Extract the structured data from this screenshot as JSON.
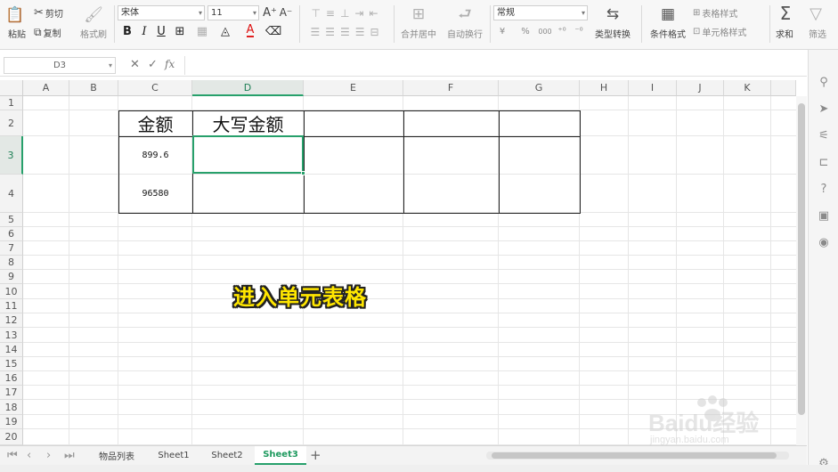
{
  "ribbon": {
    "paste_label": "粘贴",
    "cut_label": "剪切",
    "copy_label": "复制",
    "format_painter_label": "格式刷",
    "font_name": "宋体",
    "font_size": "11",
    "font_grow": "A⁺",
    "font_shrink": "A⁻",
    "bold": "B",
    "italic": "I",
    "underline": "U",
    "merge_label": "合并居中",
    "wrap_label": "自动换行",
    "number_format": "常规",
    "currency_symbol": "¥",
    "percent_symbol": "%",
    "thousands_symbol": "000",
    "convert_label": "类型转换",
    "cond_format_label": "条件格式",
    "table_style_label": "表格样式",
    "cell_style_label": "单元格样式",
    "sum_label": "求和",
    "filter_label": "筛选"
  },
  "formula_bar": {
    "name_box": "D3",
    "cancel_glyph": "✕",
    "confirm_glyph": "✓",
    "fx_label": "fx",
    "content": ""
  },
  "columns": [
    "A",
    "B",
    "C",
    "D",
    "E",
    "F",
    "G",
    "H",
    "I",
    "J",
    "K"
  ],
  "rows": [
    "1",
    "2",
    "3",
    "4",
    "5",
    "6",
    "7",
    "8",
    "9",
    "10",
    "11",
    "12",
    "13",
    "14",
    "15",
    "16",
    "17",
    "18",
    "19",
    "20"
  ],
  "selected": {
    "column": "D",
    "row": "3"
  },
  "cells": {
    "C2": "金额",
    "D2": "大写金额",
    "C3": "899.6",
    "C4": "96580"
  },
  "caption": "进入单元表格",
  "sheet_tabs": [
    {
      "label": "物品列表",
      "active": false
    },
    {
      "label": "Sheet1",
      "active": false
    },
    {
      "label": "Sheet2",
      "active": false
    },
    {
      "label": "Sheet3",
      "active": true
    }
  ],
  "add_sheet_glyph": "+",
  "watermark": {
    "brand": "Baidu经验",
    "url": "jingyan.baidu.com"
  },
  "colors": {
    "accent": "#27a06b",
    "caption": "#ffe600"
  }
}
